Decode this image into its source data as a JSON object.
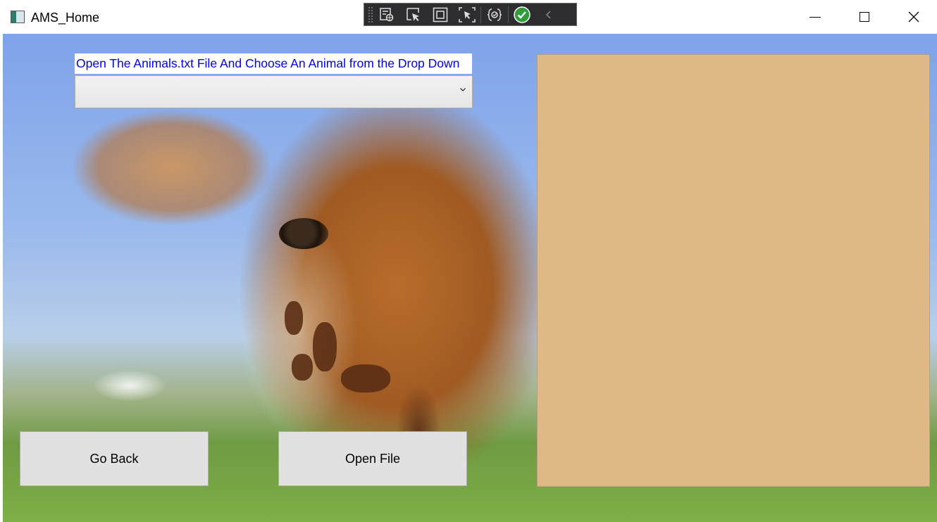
{
  "window": {
    "title": "AMS_Home",
    "controls": [
      "minimize",
      "maximize",
      "close"
    ]
  },
  "debug_toolbar": {
    "tools": [
      {
        "icon": "live-visual-tree-icon"
      },
      {
        "icon": "select-element-icon"
      },
      {
        "icon": "display-layout-adorners-icon"
      },
      {
        "icon": "track-focus-icon"
      },
      {
        "icon": "hot-reload-icon"
      },
      {
        "icon": "binding-check-icon"
      },
      {
        "icon": "collapse-chevron-icon"
      }
    ]
  },
  "main": {
    "prompt_label": "Open The Animals.txt File And Choose An Animal from the Drop Down",
    "animal_dropdown": {
      "selected": ""
    },
    "go_back_label": "Go Back",
    "open_file_label": "Open File"
  },
  "colors": {
    "prompt_text": "#0000ee",
    "display_panel": "#deb887",
    "button_bg": "#e1e1e1",
    "toolbar_bg": "#2d2d30",
    "check_green": "#2e9e3a"
  }
}
